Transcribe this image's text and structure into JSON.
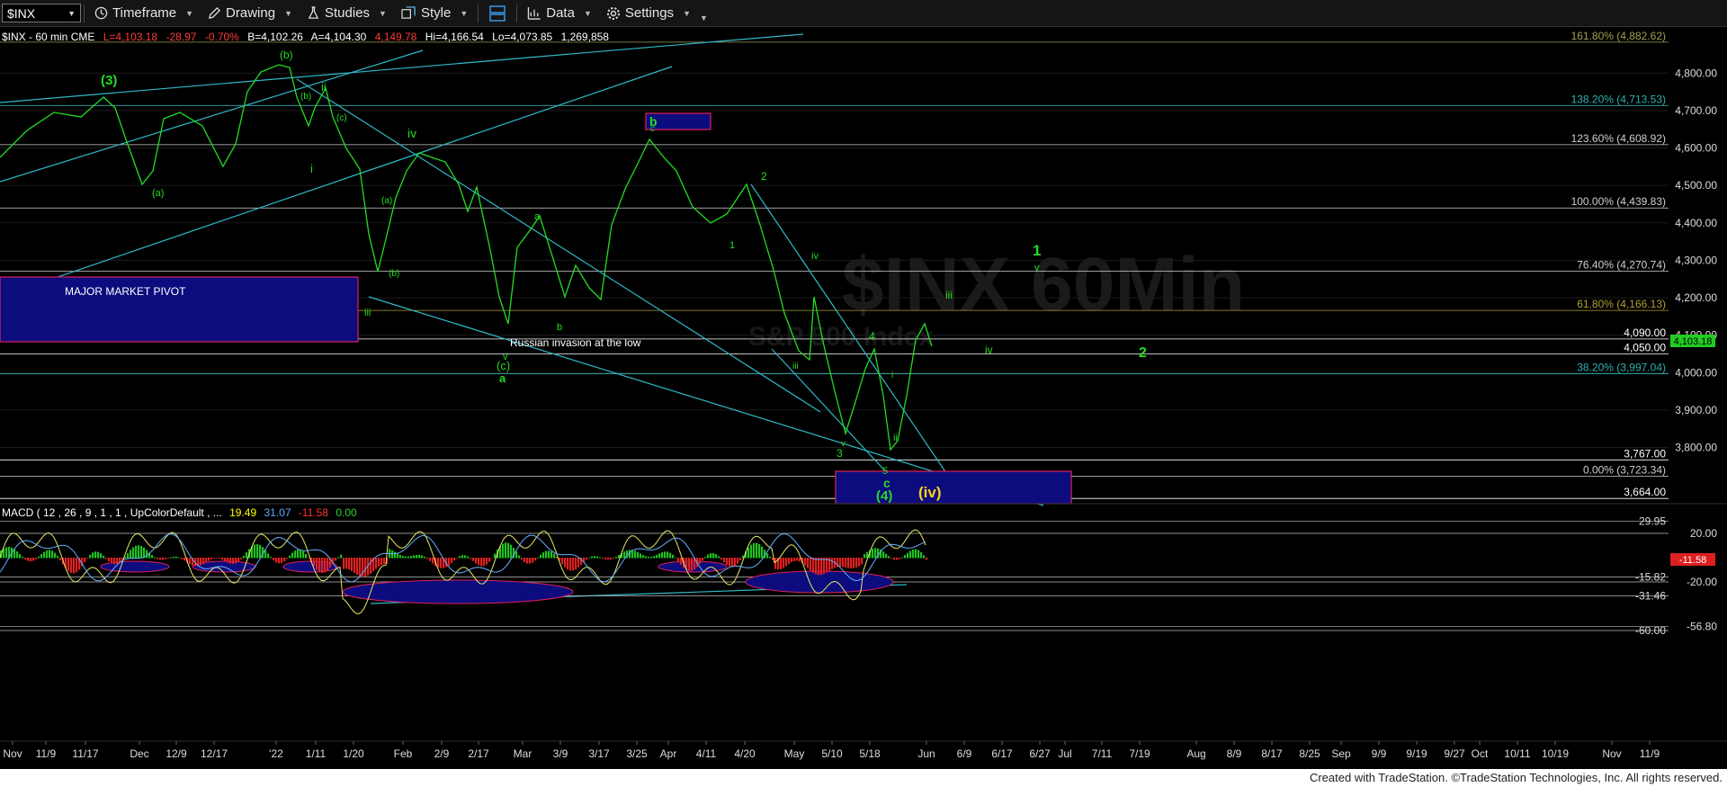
{
  "toolbar": {
    "symbol": "$INX",
    "buttons": [
      {
        "label": "Timeframe",
        "icon": "clock-icon"
      },
      {
        "label": "Drawing",
        "icon": "pencil-icon"
      },
      {
        "label": "Studies",
        "icon": "flask-icon"
      },
      {
        "label": "Style",
        "icon": "style-icon"
      },
      {
        "label": "",
        "icon": "layout-icon"
      },
      {
        "label": "Data",
        "icon": "data-icon"
      },
      {
        "label": "Settings",
        "icon": "gear-icon"
      }
    ]
  },
  "header": {
    "symbol_info": "$INX - 60 min  CME",
    "last": "L=4,103.18",
    "change": "-28.97",
    "change_pct": "-0.70%",
    "bid": "B=4,102.26",
    "ask": "A=4,104.30",
    "high": "Hi=4,166.54",
    "low": "Lo=4,073.85",
    "volume": "1,269,858",
    "extra": "4,149.78"
  },
  "watermark": {
    "line1": "$INX 60Min",
    "line2": "S&P 500 Index"
  },
  "price_axis": {
    "ticks": [
      "4,800.00",
      "4,700.00",
      "4,600.00",
      "4,500.00",
      "4,400.00",
      "4,300.00",
      "4,200.00",
      "4,100.00",
      "4,000.00",
      "3,900.00",
      "3,800.00"
    ],
    "ymin": 3650,
    "ymax": 4880,
    "current_price": "4,103.18"
  },
  "fib_levels": [
    {
      "label": "161.80% (4,882.62)",
      "value": 4882.62,
      "color": "#a0a050"
    },
    {
      "label": "138.20% (4,713.53)",
      "value": 4713.53,
      "color": "#30b0b0"
    },
    {
      "label": "123.60% (4,608.92)",
      "value": 4608.92,
      "color": "#cfcfcf"
    },
    {
      "label": "100.00% (4,439.83)",
      "value": 4439.83,
      "color": "#cfcfcf"
    },
    {
      "label": "76.40% (4,270.74)",
      "value": 4270.74,
      "color": "#cfcfcf"
    },
    {
      "label": "61.80% (4,166.13)",
      "value": 4166.13,
      "color": "#b0a030"
    },
    {
      "label": "4,090.00",
      "value": 4090.0,
      "color": "#ffffff"
    },
    {
      "label": "4,050.00",
      "value": 4050.0,
      "color": "#ffffff"
    },
    {
      "label": "38.20% (3,997.04)",
      "value": 3997.04,
      "color": "#30b0b0"
    },
    {
      "label": "3,767.00",
      "value": 3767.0,
      "color": "#ffffff"
    },
    {
      "label": "0.00% (3,723.34)",
      "value": 3723.34,
      "color": "#cfcfcf"
    },
    {
      "label": "3,664.00",
      "value": 3664.0,
      "color": "#ffffff"
    }
  ],
  "boxes": [
    {
      "label": "MAJOR MARKET PIVOT"
    },
    {
      "label": "b"
    },
    {
      "label": ""
    }
  ],
  "annotations": [
    {
      "text": "Russian invasion at the low",
      "color": "#ffffff"
    }
  ],
  "wave_labels": [
    {
      "text": "(3)"
    },
    {
      "text": "(b)"
    },
    {
      "text": "ii"
    },
    {
      "text": "iv"
    },
    {
      "text": "(a)"
    },
    {
      "text": "(b)"
    },
    {
      "text": "(c)"
    },
    {
      "text": "a"
    },
    {
      "text": "b"
    },
    {
      "text": "c"
    },
    {
      "text": "(a)"
    },
    {
      "text": "(b)"
    },
    {
      "text": "i"
    },
    {
      "text": "iii"
    },
    {
      "text": "v"
    },
    {
      "text": "(c)"
    },
    {
      "text": "a"
    },
    {
      "text": "b"
    },
    {
      "text": "c"
    },
    {
      "text": "1"
    },
    {
      "text": "2"
    },
    {
      "text": "iii"
    },
    {
      "text": "iv"
    },
    {
      "text": "v"
    },
    {
      "text": "3"
    },
    {
      "text": "4"
    },
    {
      "text": "5"
    },
    {
      "text": "c"
    },
    {
      "text": "(4)"
    },
    {
      "text": "i"
    },
    {
      "text": "ii"
    },
    {
      "text": "iii"
    },
    {
      "text": "iv"
    },
    {
      "text": "1"
    },
    {
      "text": "v"
    },
    {
      "text": "2"
    },
    {
      "text": "(iv)"
    }
  ],
  "macd": {
    "title": "MACD ( 12 , 26 , 9 , 1 , 1 , UpColorDefault , ...",
    "values": [
      "19.49",
      "31.07",
      "-11.58",
      "0.00"
    ],
    "value_colors": [
      "#ffff00",
      "#55aaff",
      "#ff3030",
      "#30d030"
    ],
    "ticks": [
      "29.95",
      "20.00",
      "-15.82",
      "-20.00",
      "-31.46",
      "-56.80",
      "-60.00"
    ],
    "current": "-11.58"
  },
  "x_axis": {
    "labels": [
      "Nov",
      "11/9",
      "11/17",
      "Dec",
      "12/9",
      "12/17",
      "'22",
      "1/11",
      "1/20",
      "Feb",
      "2/9",
      "2/17",
      "Mar",
      "3/9",
      "3/17",
      "3/25",
      "Apr",
      "4/11",
      "4/20",
      "May",
      "5/10",
      "5/18",
      "Jun",
      "6/9",
      "6/17",
      "6/27",
      "Jul",
      "7/11",
      "7/19",
      "Aug",
      "8/9",
      "8/17",
      "8/25",
      "Sep",
      "9/9",
      "9/19",
      "9/27",
      "Oct",
      "10/11",
      "10/19",
      "Nov",
      "11/9"
    ]
  },
  "footer": {
    "text": "Created with TradeStation. ©TradeStation Technologies, Inc. All rights reserved."
  },
  "colors": {
    "price": "#22dd22",
    "trend": "#30b8c8",
    "box_fill": "#0c0c7e",
    "box_border": "#e0205a"
  }
}
